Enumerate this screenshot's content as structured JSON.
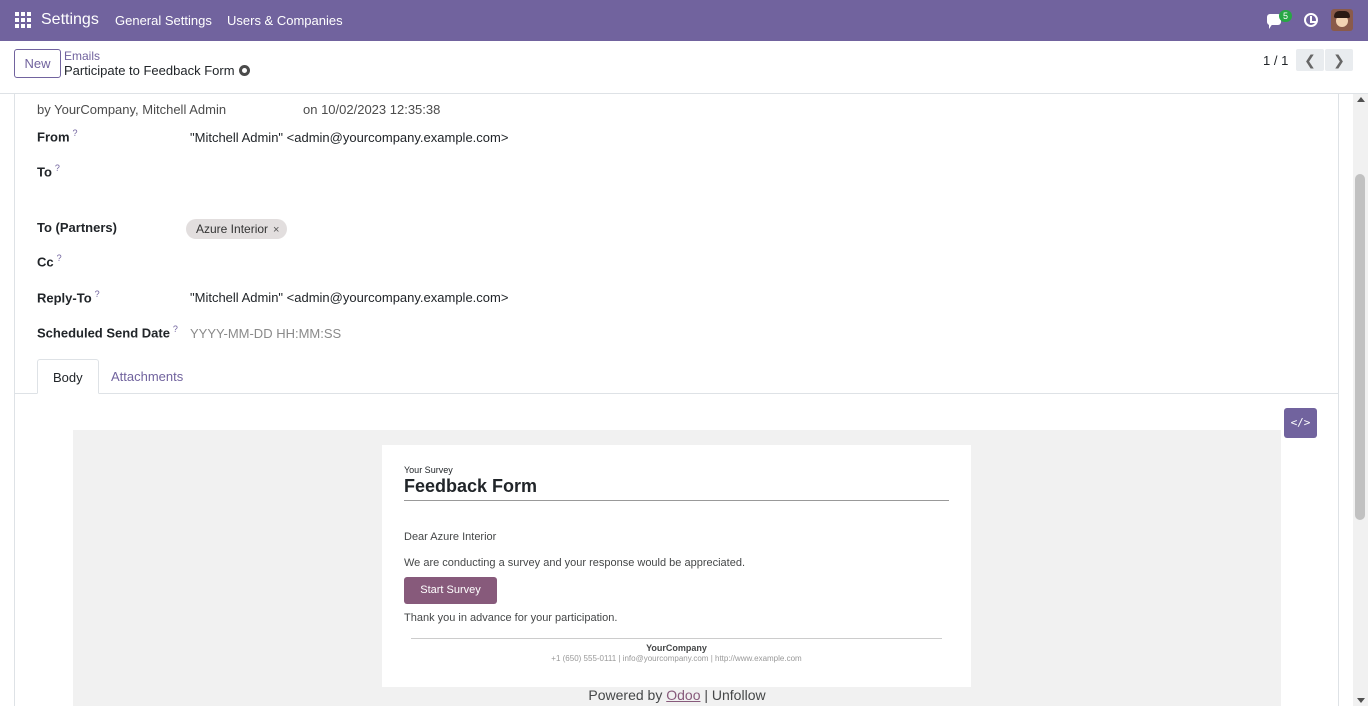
{
  "navbar": {
    "app_title": "Settings",
    "menu": [
      "General Settings",
      "Users & Companies"
    ],
    "chat_badge": "5",
    "accent": "#71639e"
  },
  "control": {
    "new_label": "New",
    "breadcrumb_parent": "Emails",
    "breadcrumb_current": "Participate to Feedback Form",
    "pager": "1 / 1",
    "prev_glyph": "❮",
    "next_glyph": "❯"
  },
  "form": {
    "author": "by  YourCompany, Mitchell Admin",
    "date": "on 10/02/2023 12:35:38",
    "fields": {
      "from_label": "From",
      "from_value": "\"Mitchell Admin\" <admin@yourcompany.example.com>",
      "to_label": "To",
      "to_partners_label": "To (Partners)",
      "partner_tag": "Azure Interior",
      "cc_label": "Cc",
      "reply_to_label": "Reply-To",
      "reply_to_value": "\"Mitchell Admin\" <admin@yourcompany.example.com>",
      "scheduled_label": "Scheduled Send Date",
      "scheduled_placeholder": "YYYY-MM-DD HH:MM:SS"
    },
    "help_mark": "?",
    "tabs": [
      "Body",
      "Attachments"
    ],
    "code_view_glyph": "</>"
  },
  "email": {
    "kicker": "Your Survey",
    "title": "Feedback Form",
    "greeting": "Dear Azure Interior",
    "message": "We are conducting a survey and your response would be appreciated.",
    "button": "Start Survey",
    "closing": "Thank you in advance for your participation.",
    "footer_company": "YourCompany",
    "footer_contact": "+1 (650) 555-0111 | info@yourcompany.com | http://www.example.com",
    "powered_prefix": "Powered by ",
    "powered_link": "Odoo",
    "powered_suffix": " | Unfollow",
    "button_color": "#875a7b"
  }
}
